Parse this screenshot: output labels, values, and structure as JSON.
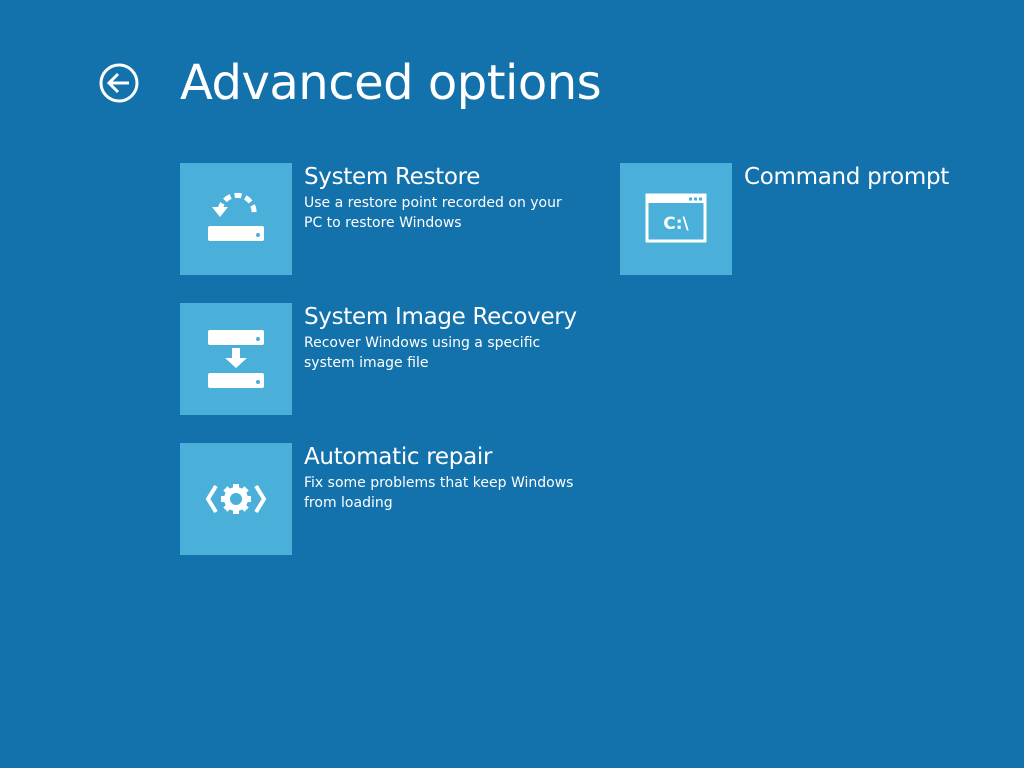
{
  "header": {
    "title": "Advanced options",
    "back_icon": "back-arrow-circle-icon"
  },
  "colors": {
    "background": "#1372ac",
    "tile": "#4aafd9",
    "text": "#ffffff"
  },
  "options": [
    {
      "label": "System Restore",
      "description": "Use a restore point recorded on your PC to restore Windows",
      "icon": "system-restore-icon"
    },
    {
      "label": "System Image Recovery",
      "description": "Recover Windows using a specific system image file",
      "icon": "system-image-recovery-icon"
    },
    {
      "label": "Automatic repair",
      "description": "Fix some problems that keep Windows from loading",
      "icon": "automatic-repair-icon"
    },
    {
      "label": "Command prompt",
      "description": "",
      "icon": "command-prompt-icon",
      "icon_text": "C:\\"
    }
  ]
}
